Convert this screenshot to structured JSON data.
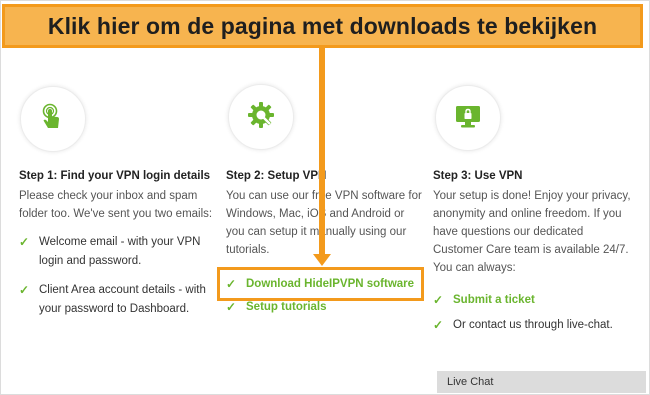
{
  "banner": {
    "text": "Klik hier om de pagina met downloads te bekijken"
  },
  "colors": {
    "accent_orange": "#f39a1c",
    "banner_fill": "#f7b44f",
    "brand_green": "#6ab52e"
  },
  "steps": [
    {
      "icon": "touch-hand-icon",
      "title": "Step 1: Find your VPN login details",
      "description": "Please check your inbox and spam folder too. We've sent you two emails:",
      "items": [
        {
          "label": "Welcome email - with your VPN login and password."
        },
        {
          "label": "Client Area account details - with your password to Dashboard."
        }
      ]
    },
    {
      "icon": "gear-wrench-icon",
      "title": "Step 2: Setup VPN",
      "description": "You can use our free VPN software for Windows, Mac, iOS and Android or you can setup it manually using our tutorials.",
      "items": [
        {
          "label": "Download HideIPVPN software"
        },
        {
          "label": "Setup tutorials"
        }
      ]
    },
    {
      "icon": "monitor-lock-icon",
      "title": "Step 3: Use VPN",
      "description": "Your setup is done! Enjoy your privacy, anonymity and online freedom. If you have questions our dedicated Customer Care team is available 24/7. You can always:",
      "items": [
        {
          "label": "Submit a ticket"
        },
        {
          "label": "Or contact us through live-chat."
        }
      ]
    }
  ],
  "live_chat": {
    "label": "Live Chat"
  }
}
